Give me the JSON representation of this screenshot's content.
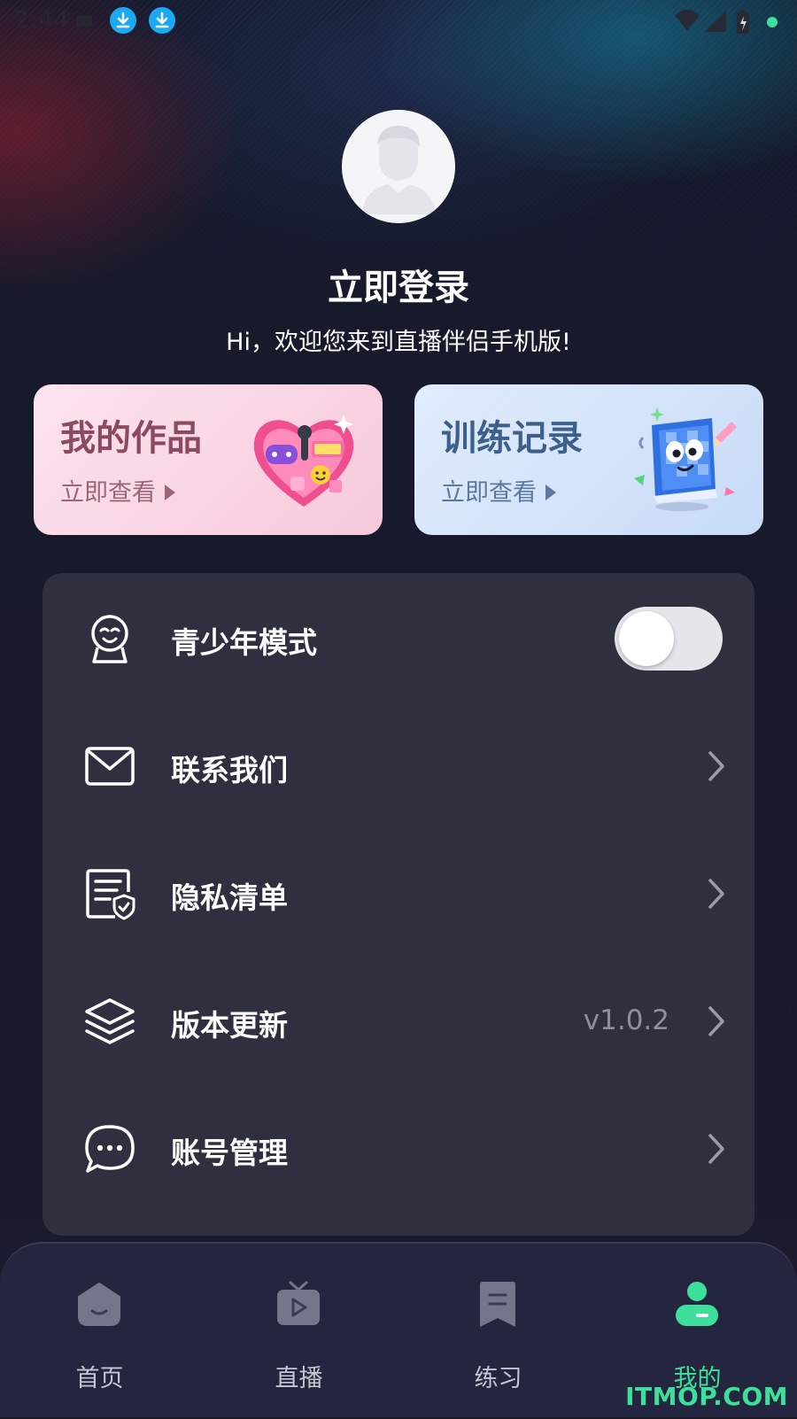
{
  "status_bar": {
    "time": "2:44"
  },
  "profile": {
    "login_title": "立即登录",
    "welcome_text": "Hi，欢迎您来到直播伴侣手机版!"
  },
  "cards": [
    {
      "title": "我的作品",
      "link_label": "立即查看"
    },
    {
      "title": "训练记录",
      "link_label": "立即查看"
    }
  ],
  "menu": {
    "items": [
      {
        "label": "青少年模式",
        "icon": "child-face-icon",
        "toggle_on": false
      },
      {
        "label": "联系我们",
        "icon": "mail-icon"
      },
      {
        "label": "隐私清单",
        "icon": "privacy-document-icon"
      },
      {
        "label": "版本更新",
        "icon": "layers-icon",
        "value": "v1.0.2"
      },
      {
        "label": "账号管理",
        "icon": "chat-bubble-icon"
      }
    ]
  },
  "bottom_nav": {
    "items": [
      {
        "label": "首页",
        "icon": "home-icon",
        "active": false
      },
      {
        "label": "直播",
        "icon": "live-tv-icon",
        "active": false
      },
      {
        "label": "练习",
        "icon": "practice-bookmark-icon",
        "active": false
      },
      {
        "label": "我的",
        "icon": "profile-icon",
        "active": true
      }
    ]
  },
  "watermark": "ITMOP.COM",
  "colors": {
    "accent": "#3de09a",
    "download_badge": "#1aa9f2",
    "panel": "#2e2f3f",
    "nav_bg": "#242640"
  }
}
